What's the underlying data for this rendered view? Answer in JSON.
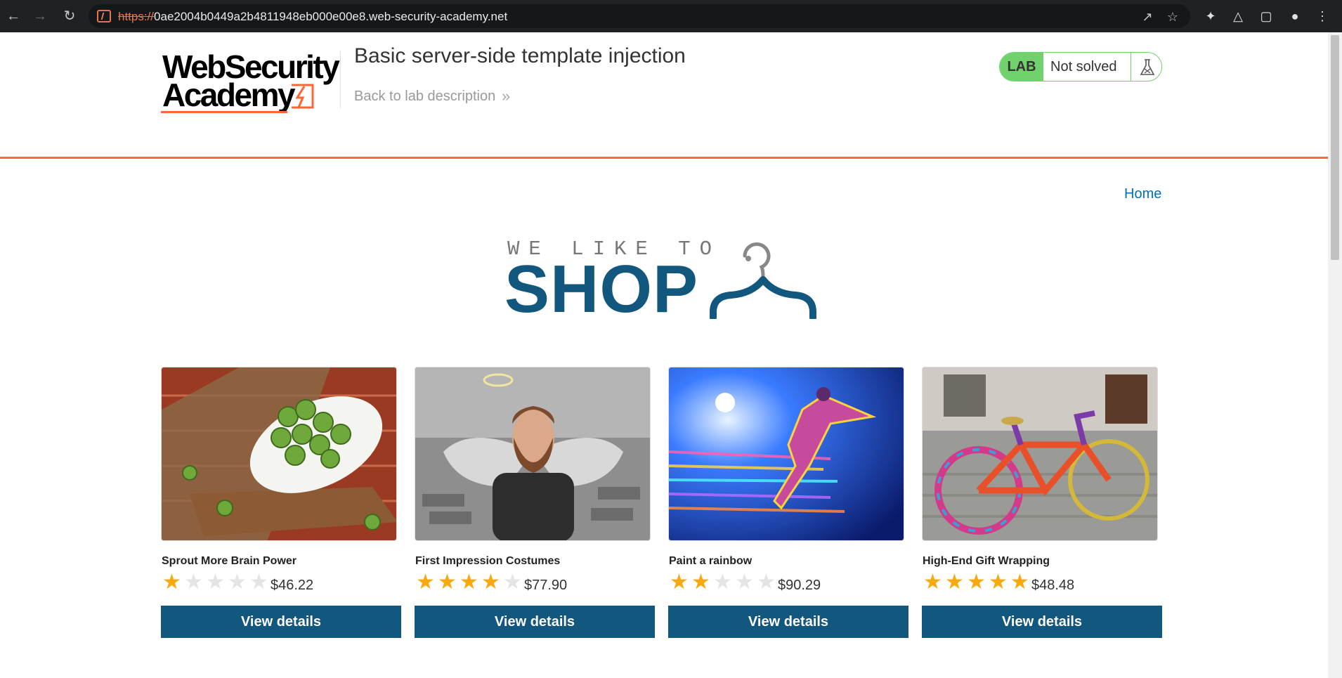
{
  "browser": {
    "url_scheme": "https://",
    "url_host": "0ae2004b0449a2b4811948eb000e00e8.web-security-academy.net",
    "nav": {
      "back_icon": "arrow-left-icon",
      "forward_icon": "arrow-right-icon",
      "reload_icon": "reload-icon"
    }
  },
  "header": {
    "logo_line1": "WebSecurity",
    "logo_line2": "Academy",
    "lab_title": "Basic server-side template injection",
    "back_link": "Back to lab description",
    "lab_badge": "LAB",
    "lab_status": "Not solved"
  },
  "nav": {
    "home": "Home"
  },
  "banner": {
    "top": "WE LIKE TO",
    "main": "SHOP"
  },
  "products": [
    {
      "name": "Sprout More Brain Power",
      "rating": 1,
      "price": "$46.22",
      "button": "View details"
    },
    {
      "name": "First Impression Costumes",
      "rating": 4,
      "price": "$77.90",
      "button": "View details"
    },
    {
      "name": "Paint a rainbow",
      "rating": 2,
      "price": "$90.29",
      "button": "View details"
    },
    {
      "name": "High-End Gift Wrapping",
      "rating": 5,
      "price": "$48.48",
      "button": "View details"
    }
  ],
  "colors": {
    "accent_orange": "#ff6633",
    "brand_blue": "#11577e",
    "lab_green": "#70d16d",
    "star": "#f7a90f",
    "link": "#0071bc"
  }
}
